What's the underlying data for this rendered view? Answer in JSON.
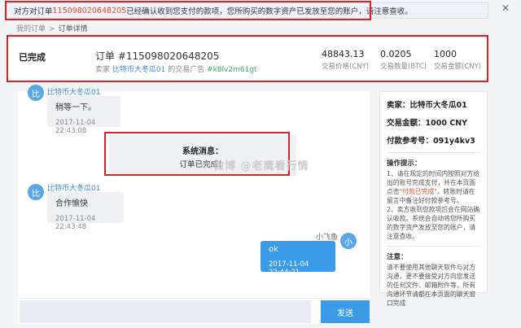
{
  "notice": {
    "prefix": "对方对订单 ",
    "order_no": "115098020648205",
    "suffix": " 已经确认收到您支付的款项，您所购买的数字资产已发放至您的账户，请注意查收。",
    "close": "✕"
  },
  "breadcrumb": {
    "home": "我的订单",
    "sep": ">",
    "current": "订单详情"
  },
  "summary": {
    "status": "已完成",
    "order_title": "订单 #115098020648205",
    "seller_prefix": "卖家 ",
    "seller_name": "比特币大冬瓜01",
    "seller_mid": " 的交易广告 ",
    "ad_code": "#k8lv2m61gt",
    "stats": [
      {
        "value": "48843.13",
        "label": "交易价格(CNY)"
      },
      {
        "value": "0.0205",
        "label": "交易数量(BTC)"
      },
      {
        "value": "1000",
        "label": "交易金额(CNY)"
      }
    ]
  },
  "chat": {
    "msg1": {
      "avatar": "比",
      "name": "比特币大冬瓜01",
      "text": "稍等一下。",
      "time": "2017-11-04 22:43:08"
    },
    "system": {
      "title": "系统消息：",
      "body": "订单已完成！"
    },
    "msg2": {
      "avatar": "比",
      "name": "比特币大冬瓜01",
      "text": "合作愉快",
      "time": "2017-11-04 22:43:48"
    },
    "msg3": {
      "avatar": "小",
      "name": "小飞鱼",
      "text": "ok",
      "time": "2017-11-04 22:44:21"
    },
    "watermark": "微博 @老鹰看行情",
    "input_placeholder": "",
    "send_label": "发送"
  },
  "side": {
    "seller": "卖家：比特币大冬瓜01",
    "amount": "交易金额：1000 CNY",
    "ref": "付款参考号：091y4kv3",
    "tips_title": "操作提示：",
    "tip1a": "1、请在规定的时间内按照对方给出的账号完成支付，并在本页面点击",
    "tip1_red": "\"付款已完成\"",
    "tip1b": "。转账时请在留言中备注好付款参考号。",
    "tip2": "2、卖方收到您款项后会在网站确认收款。系统会自动将您所购买的数字资产发放至您的账户，请注意查收。",
    "note_title": "注意：",
    "note": "请不要使用其他聊天软件与对方沟通，更不要接受对方向您发送的任何文件、邮箱附件等，所有沟通环节请都在本页面的聊天窗口完成"
  },
  "colors": {
    "accent": "#3b9be8",
    "highlight": "#d6242a",
    "order_red": "#e0502a"
  }
}
